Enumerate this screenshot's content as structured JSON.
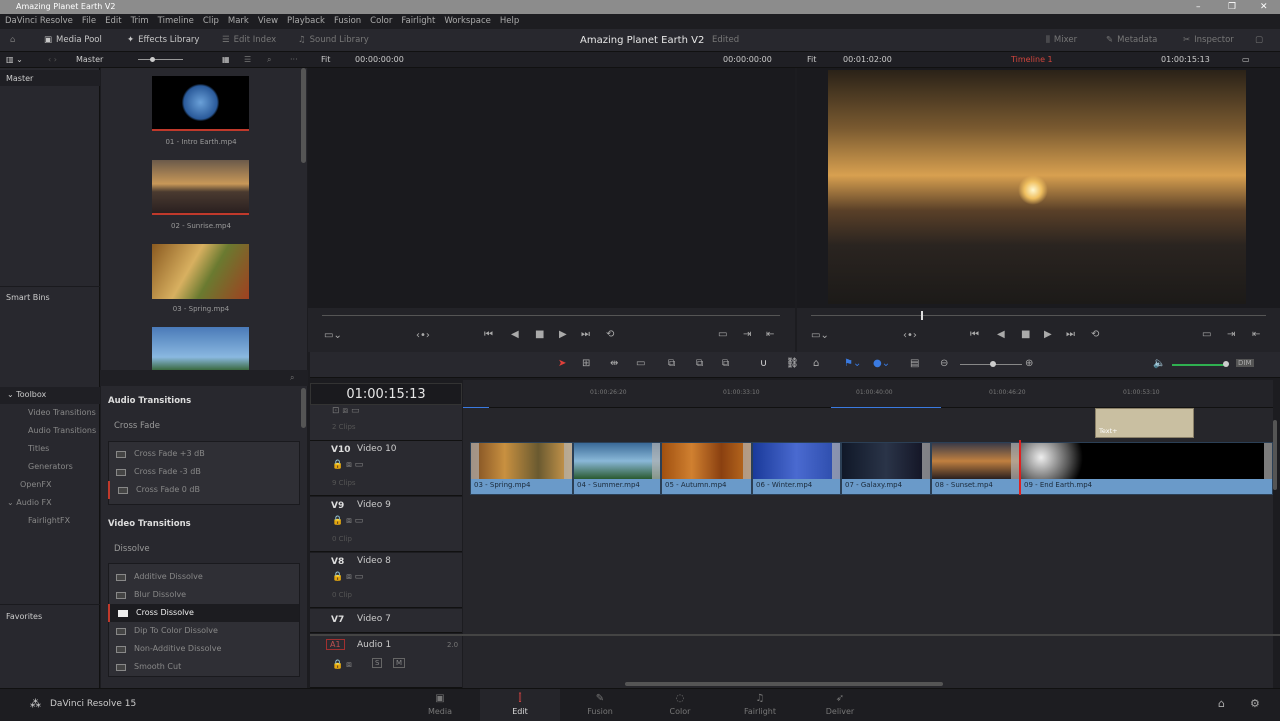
{
  "window": {
    "title": "Amazing Planet Earth V2",
    "minimize": "–",
    "restore": "❐",
    "close": "✕"
  },
  "menu": [
    "DaVinci Resolve",
    "File",
    "Edit",
    "Trim",
    "Timeline",
    "Clip",
    "Mark",
    "View",
    "Playback",
    "Fusion",
    "Color",
    "Fairlight",
    "Workspace",
    "Help"
  ],
  "toolbar": {
    "media_pool": "Media Pool",
    "effects_library": "Effects Library",
    "edit_index": "Edit Index",
    "sound_library": "Sound Library",
    "project_title": "Amazing Planet Earth V2",
    "project_status": "Edited",
    "mixer": "Mixer",
    "metadata": "Metadata",
    "inspector": "Inspector"
  },
  "subbar": {
    "bin": "Master",
    "source_zoom": "Fit",
    "source_tc": "00:00:00:00",
    "source_tc_right": "00:00:00:00",
    "program_zoom": "Fit",
    "program_duration": "00:01:02:00",
    "timeline_name": "Timeline 1",
    "program_tc": "01:00:15:13"
  },
  "bins": {
    "master": "Master",
    "smart_bins": "Smart Bins"
  },
  "media": [
    {
      "name": "01 - Intro Earth.mp4"
    },
    {
      "name": "02 - Sunrise.mp4"
    },
    {
      "name": "03 - Spring.mp4"
    },
    {
      "name": ""
    }
  ],
  "effects": {
    "nav": [
      {
        "label": "Toolbox",
        "chevron": "⌄"
      },
      {
        "label": "Video Transitions"
      },
      {
        "label": "Audio Transitions"
      },
      {
        "label": "Titles"
      },
      {
        "label": "Generators"
      },
      {
        "label": "OpenFX"
      },
      {
        "label": "Audio FX",
        "chevron": "⌄"
      },
      {
        "label": "FairlightFX"
      }
    ],
    "favorites": "Favorites",
    "audio_heading": "Audio Transitions",
    "audio_group": "Cross Fade",
    "audio_items": [
      "Cross Fade +3 dB",
      "Cross Fade -3 dB",
      "Cross Fade 0 dB"
    ],
    "video_heading": "Video Transitions",
    "video_group": "Dissolve",
    "video_items": [
      "Additive Dissolve",
      "Blur Dissolve",
      "Cross Dissolve",
      "Dip To Color Dissolve",
      "Non-Additive Dissolve",
      "Smooth Cut"
    ],
    "selected": "Cross Dissolve"
  },
  "timeline": {
    "timecode": "01:00:15:13",
    "ruler": [
      "01:00:26:20",
      "01:00:33:10",
      "01:00:40:00",
      "01:00:46:20",
      "01:00:53:10"
    ],
    "tracks": [
      {
        "id": "",
        "name": "",
        "clips": "2 Clips"
      },
      {
        "id": "V10",
        "name": "Video 10",
        "clips": "9 Clips"
      },
      {
        "id": "V9",
        "name": "Video 9",
        "clips": "0 Clip"
      },
      {
        "id": "V8",
        "name": "Video 8",
        "clips": "0 Clip"
      },
      {
        "id": "V7",
        "name": "Video 7",
        "clips": ""
      }
    ],
    "audio": {
      "id": "A1",
      "name": "Audio 1",
      "channels": "2.0",
      "solo": "S",
      "mute": "M"
    },
    "title_clip": "Text+",
    "clips": [
      "03 - Spring.mp4",
      "04 - Summer.mp4",
      "05 - Autumn.mp4",
      "06 - Winter.mp4",
      "07 - Galaxy.mp4",
      "08 - Sunset.mp4",
      "09 - End Earth.mp4"
    ]
  },
  "pages": {
    "app": "DaVinci Resolve 15",
    "items": [
      "Media",
      "Edit",
      "Fusion",
      "Color",
      "Fairlight",
      "Deliver"
    ],
    "active": "Edit"
  },
  "colors": {
    "accent_red": "#e0403a",
    "clip_blue": "#6a9ac9",
    "playhead": "#e02020"
  }
}
